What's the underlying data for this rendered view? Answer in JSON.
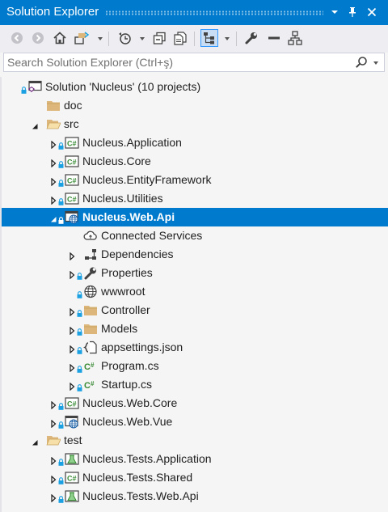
{
  "window": {
    "title": "Solution Explorer"
  },
  "search": {
    "placeholder": "Search Solution Explorer (Ctrl+ş)"
  },
  "colors": {
    "accent": "#007acc",
    "csharp_green": "#388a34",
    "folder": "#dcb67a",
    "lock_blue": "#1ba1e2"
  },
  "tree": [
    {
      "label": "Solution 'Nucleus' (10 projects)",
      "icon": "solution-icon",
      "level": 0,
      "expand": "none",
      "lock": true
    },
    {
      "label": "doc",
      "icon": "folder-icon",
      "level": 1,
      "expand": "none",
      "lock": false
    },
    {
      "label": "src",
      "icon": "folder-open-icon",
      "level": 1,
      "expand": "expanded",
      "lock": false
    },
    {
      "label": "Nucleus.Application",
      "icon": "csharp-project-icon",
      "level": 2,
      "expand": "collapsed",
      "lock": true
    },
    {
      "label": "Nucleus.Core",
      "icon": "csharp-project-icon",
      "level": 2,
      "expand": "collapsed",
      "lock": true
    },
    {
      "label": "Nucleus.EntityFramework",
      "icon": "csharp-project-icon",
      "level": 2,
      "expand": "collapsed",
      "lock": true
    },
    {
      "label": "Nucleus.Utilities",
      "icon": "csharp-project-icon",
      "level": 2,
      "expand": "collapsed",
      "lock": true
    },
    {
      "label": "Nucleus.Web.Api",
      "icon": "web-project-icon",
      "level": 2,
      "expand": "expanded",
      "lock": true,
      "selected": true
    },
    {
      "label": "Connected Services",
      "icon": "cloud-icon",
      "level": 3,
      "expand": "none",
      "lock": false
    },
    {
      "label": "Dependencies",
      "icon": "dependencies-icon",
      "level": 3,
      "expand": "collapsed",
      "lock": false
    },
    {
      "label": "Properties",
      "icon": "wrench-icon",
      "level": 3,
      "expand": "collapsed",
      "lock": true
    },
    {
      "label": "wwwroot",
      "icon": "globe-icon",
      "level": 3,
      "expand": "none",
      "lock": true
    },
    {
      "label": "Controller",
      "icon": "folder-icon",
      "level": 3,
      "expand": "collapsed",
      "lock": true
    },
    {
      "label": "Models",
      "icon": "folder-icon",
      "level": 3,
      "expand": "collapsed",
      "lock": true
    },
    {
      "label": "appsettings.json",
      "icon": "json-file-icon",
      "level": 3,
      "expand": "collapsed",
      "lock": true
    },
    {
      "label": "Program.cs",
      "icon": "csharp-file-icon",
      "level": 3,
      "expand": "collapsed",
      "lock": true
    },
    {
      "label": "Startup.cs",
      "icon": "csharp-file-icon",
      "level": 3,
      "expand": "collapsed",
      "lock": true
    },
    {
      "label": "Nucleus.Web.Core",
      "icon": "csharp-project-icon",
      "level": 2,
      "expand": "collapsed",
      "lock": true
    },
    {
      "label": "Nucleus.Web.Vue",
      "icon": "web-project-icon",
      "level": 2,
      "expand": "collapsed",
      "lock": true
    },
    {
      "label": "test",
      "icon": "folder-open-icon",
      "level": 1,
      "expand": "expanded",
      "lock": false
    },
    {
      "label": "Nucleus.Tests.Application",
      "icon": "test-project-icon",
      "level": 2,
      "expand": "collapsed",
      "lock": true
    },
    {
      "label": "Nucleus.Tests.Shared",
      "icon": "csharp-project-icon",
      "level": 2,
      "expand": "collapsed",
      "lock": true
    },
    {
      "label": "Nucleus.Tests.Web.Api",
      "icon": "test-project-icon",
      "level": 2,
      "expand": "collapsed",
      "lock": true
    }
  ]
}
